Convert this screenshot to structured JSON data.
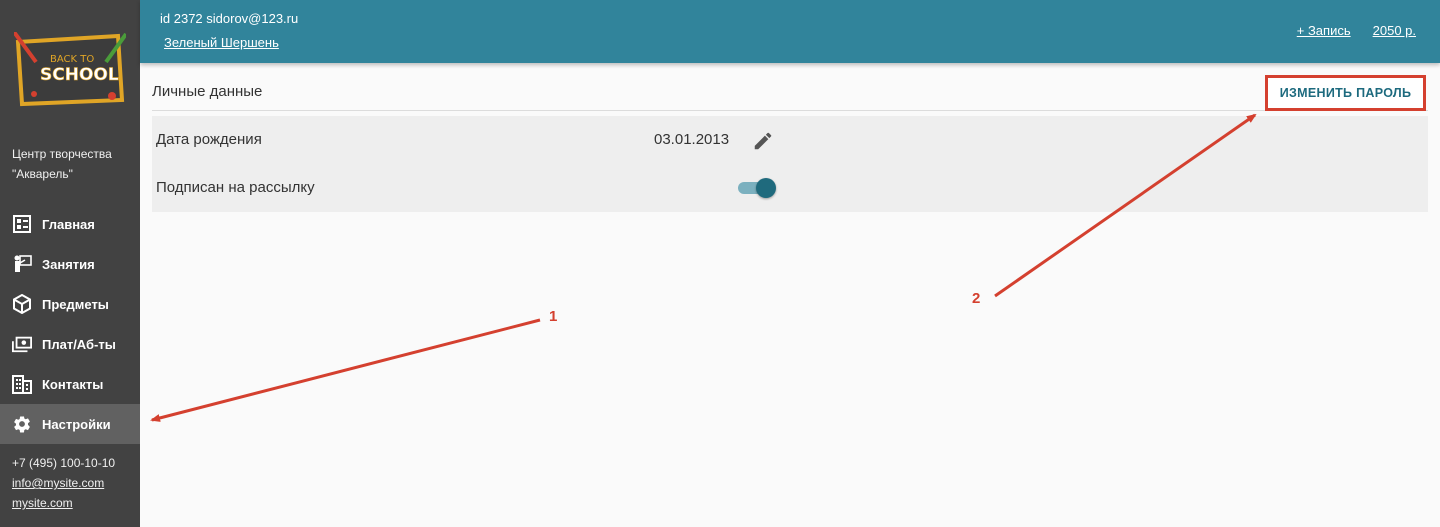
{
  "topbar": {
    "user_id": "id 2372 sidorov@123.ru",
    "user_name": "Зеленый Шершень",
    "add_entry": "+ Запись",
    "balance": "2050 р."
  },
  "sidebar": {
    "logo_text_1": "BACK TO",
    "logo_text_2": "SCHOOL",
    "org_name": "Центр творчества \"Акварель\"",
    "items": [
      {
        "label": "Главная",
        "icon": "dashboard-icon"
      },
      {
        "label": "Занятия",
        "icon": "teacher-icon"
      },
      {
        "label": "Предметы",
        "icon": "box-icon"
      },
      {
        "label": "Плат/Аб-ты",
        "icon": "money-icon"
      },
      {
        "label": "Контакты",
        "icon": "building-icon"
      },
      {
        "label": "Настройки",
        "icon": "gear-icon",
        "active": true
      }
    ],
    "phone": "+7 (495) 100-10-10",
    "email": "info@mysite.com",
    "site": "mysite.com"
  },
  "main": {
    "section_title": "Личные данные",
    "change_password": "ИЗМЕНИТЬ ПАРОЛЬ",
    "birth_label": "Дата рождения",
    "birth_value": "03.01.2013",
    "subscribe_label": "Подписан на рассылку",
    "subscribed": true
  },
  "annotations": {
    "label_1": "1",
    "label_2": "2",
    "color": "#d4402f"
  },
  "colors": {
    "topbar": "#31849b",
    "sidebar": "#424242",
    "accent": "#1f6a7d"
  }
}
